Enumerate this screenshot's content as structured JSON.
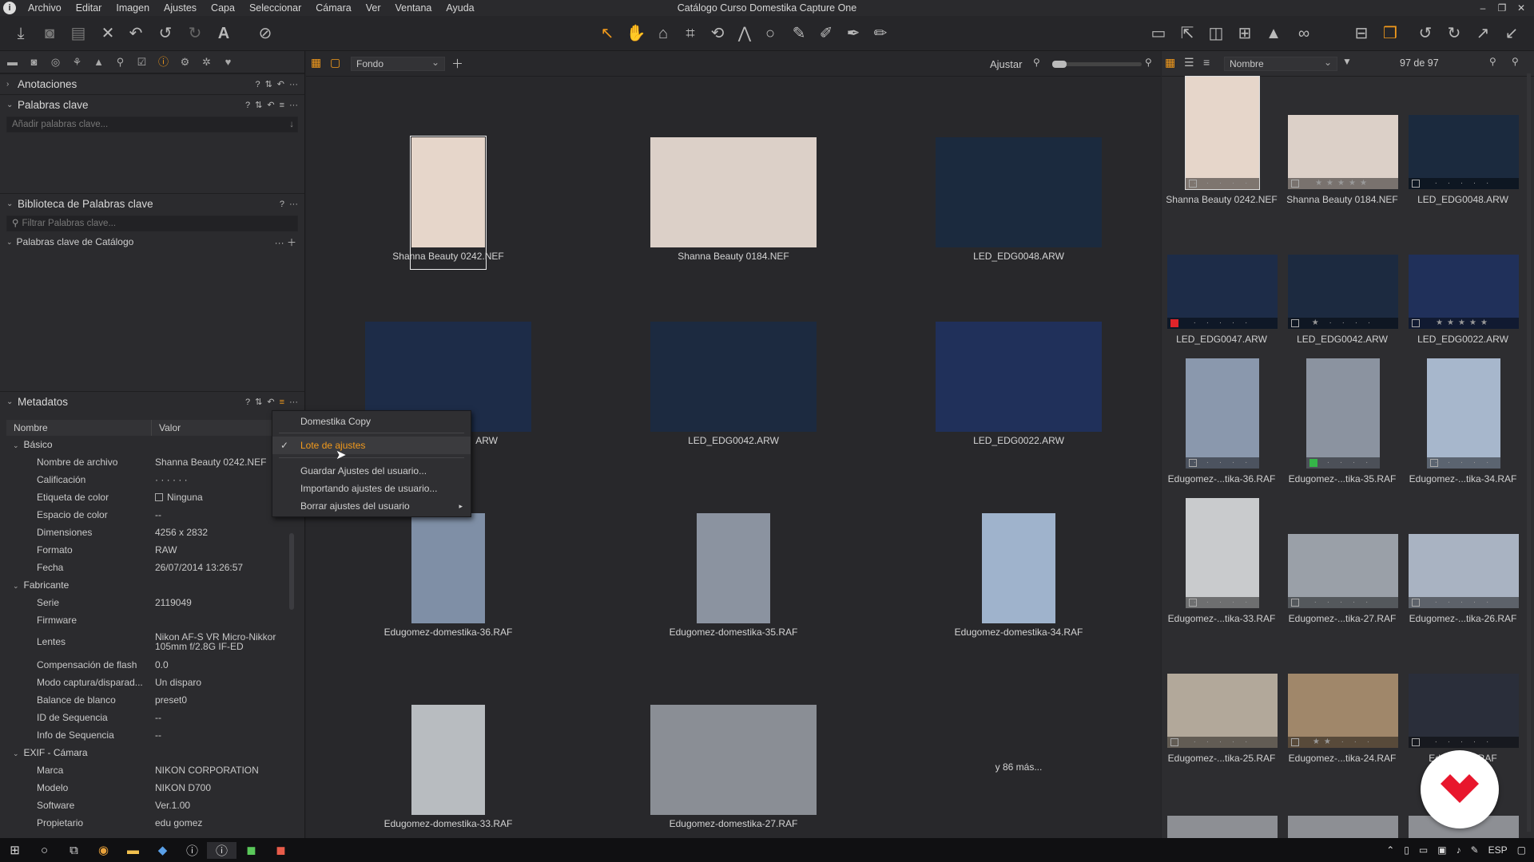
{
  "window": {
    "title": "Catálogo Curso Domestika Capture One"
  },
  "menu": [
    "Archivo",
    "Editar",
    "Imagen",
    "Ajustes",
    "Capa",
    "Seleccionar",
    "Cámara",
    "Ver",
    "Ventana",
    "Ayuda"
  ],
  "panels": {
    "annotations": "Anotaciones",
    "keywords": "Palabras clave",
    "add_keywords_placeholder": "Añadir palabras clave...",
    "keyword_library": "Biblioteca de Palabras clave",
    "filter_keywords_placeholder": "Filtrar Palabras clave...",
    "catalog_keywords": "Palabras clave de Catálogo",
    "metadata": "Metadatos"
  },
  "metadata": {
    "col_name": "Nombre",
    "col_value": "Valor",
    "groups": [
      {
        "name": "Básico",
        "rows": [
          {
            "k": "Nombre de archivo",
            "v": "Shanna Beauty 0242.NEF"
          },
          {
            "k": "Calificación",
            "v": "· · · · · ·"
          },
          {
            "k": "Etiqueta de color",
            "v": "Ninguna"
          },
          {
            "k": "Espacio de color",
            "v": "--"
          },
          {
            "k": "Dimensiones",
            "v": "4256 x 2832"
          },
          {
            "k": "Formato",
            "v": "RAW"
          },
          {
            "k": "Fecha",
            "v": "26/07/2014 13:26:57"
          }
        ]
      },
      {
        "name": "Fabricante",
        "rows": [
          {
            "k": "Serie",
            "v": "2119049"
          },
          {
            "k": "Firmware",
            "v": ""
          },
          {
            "k": "Lentes",
            "v": "Nikon AF-S VR Micro-Nikkor",
            "v2": "105mm f/2.8G IF-ED"
          },
          {
            "k": "Compensación de flash",
            "v": "0.0"
          },
          {
            "k": "Modo captura/disparad...",
            "v": "Un disparo"
          },
          {
            "k": "Balance de blanco",
            "v": "preset0"
          },
          {
            "k": "ID de Sequencia",
            "v": "--"
          },
          {
            "k": "Info de Sequencia",
            "v": "--"
          }
        ]
      },
      {
        "name": "EXIF - Cámara",
        "rows": [
          {
            "k": "Marca",
            "v": "NIKON CORPORATION"
          },
          {
            "k": "Modelo",
            "v": "NIKON D700"
          },
          {
            "k": "Software",
            "v": "Ver.1.00"
          },
          {
            "k": "Propietario",
            "v": "edu gomez"
          }
        ]
      }
    ]
  },
  "context_menu": {
    "items": [
      "Domestika Copy",
      "Lote de ajustes",
      "Guardar Ajustes del usuario...",
      "Importando ajustes de usuario...",
      "Borrar ajustes del usuario"
    ],
    "active_color": "#f29a1c"
  },
  "viewer": {
    "background_select": "Fondo",
    "fit_label": "Ajustar",
    "more_label": "y 86 más...",
    "captions": [
      "Shanna Beauty 0242.NEF",
      "Shanna Beauty 0184.NEF",
      "LED_EDG0048.ARW",
      "ARW",
      "LED_EDG0042.ARW",
      "LED_EDG0022.ARW",
      "Edugomez-domestika-36.RAF",
      "Edugomez-domestika-35.RAF",
      "Edugomez-domestika-34.RAF",
      "Edugomez-domestika-33.RAF",
      "Edugomez-domestika-27.RAF"
    ]
  },
  "browser": {
    "sort_select": "Nombre",
    "count": "97 de 97",
    "captions": [
      "Shanna Beauty 0242.NEF",
      "Shanna Beauty 0184.NEF",
      "LED_EDG0048.ARW",
      "LED_EDG0047.ARW",
      "LED_EDG0042.ARW",
      "LED_EDG0022.ARW",
      "Edugomez-...tika-36.RAF",
      "Edugomez-...tika-35.RAF",
      "Edugomez-...tika-34.RAF",
      "Edugomez-...tika-33.RAF",
      "Edugomez-...tika-27.RAF",
      "Edugomez-...tika-26.RAF",
      "Edugomez-...tika-25.RAF",
      "Edugomez-...tika-24.RAF",
      "Edugo...23.RAF"
    ]
  },
  "taskbar": {
    "lang": "ESP"
  }
}
